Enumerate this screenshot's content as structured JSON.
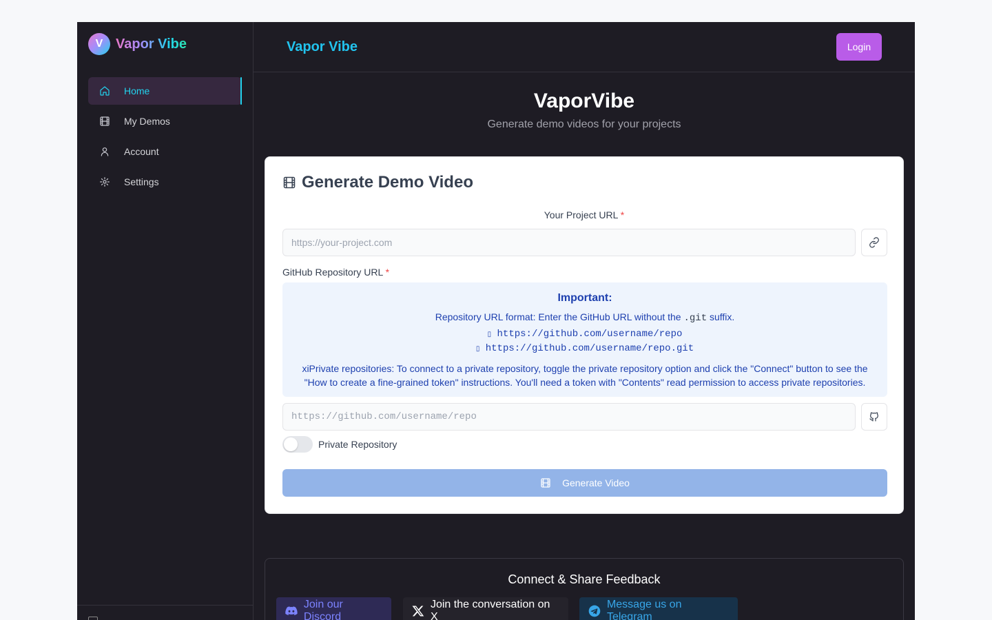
{
  "brand": {
    "logo_letter": "V",
    "name": "Vapor Vibe"
  },
  "sidebar": {
    "items": [
      {
        "label": "Home",
        "icon": "home-icon",
        "active": true
      },
      {
        "label": "My Demos",
        "icon": "film-icon",
        "active": false
      },
      {
        "label": "Account",
        "icon": "user-icon",
        "active": false
      },
      {
        "label": "Settings",
        "icon": "gear-icon",
        "active": false
      }
    ]
  },
  "header": {
    "title": "Vapor Vibe",
    "login_label": "Login"
  },
  "hero": {
    "title": "VaporVibe",
    "subtitle": "Generate demo videos for your projects"
  },
  "form": {
    "card_title": "Generate Demo Video",
    "project_url_label": "Your Project URL",
    "required_mark": "*",
    "project_url_placeholder": "https://your-project.com",
    "github_label": "GitHub Repository URL",
    "info": {
      "title": "Important:",
      "format_prefix": "Repository URL format: Enter the GitHub URL without the",
      "format_code": ".git",
      "format_suffix": "suffix.",
      "good_example": "https://github.com/username/repo",
      "bad_example": "https://github.com/username/repo.git",
      "private_note": "xiPrivate repositories: To connect to a private repository, toggle the private repository option and click the \"Connect\" button to see the \"How to create a fine-grained token\" instructions. You'll need a token with \"Contents\" read permission to access private repositories."
    },
    "github_placeholder": "https://github.com/username/repo",
    "private_label": "Private Repository",
    "private_enabled": false,
    "generate_label": "Generate Video"
  },
  "feedback": {
    "title": "Connect & Share Feedback",
    "discord_label": "Join our Discord",
    "x_label": "Join the conversation on X",
    "telegram_label": "Message us on Telegram"
  },
  "colors": {
    "accent_cyan": "#22d3ee",
    "login_purple": "#b95ce8",
    "generate_disabled": "#93b4e8",
    "info_blue": "#1e40af"
  }
}
